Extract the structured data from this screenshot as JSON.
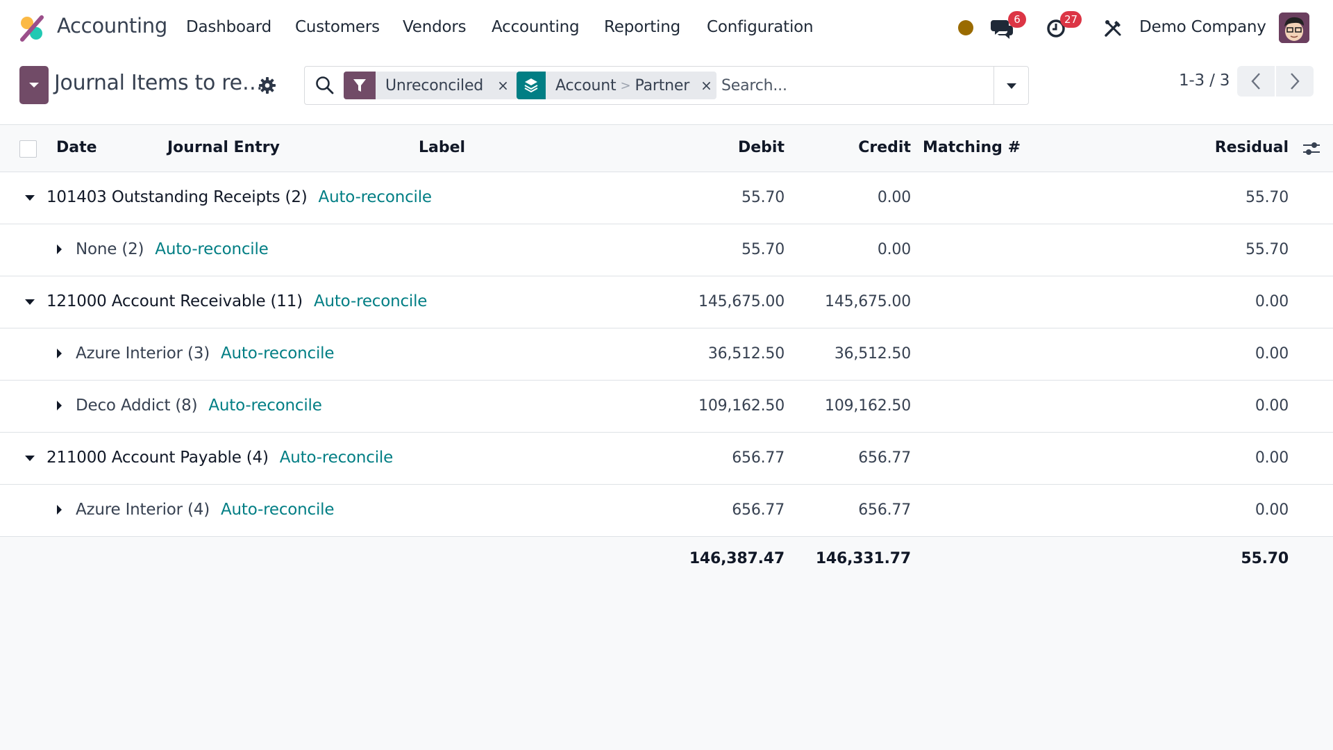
{
  "navbar": {
    "app_name": "Accounting",
    "menu": [
      "Dashboard",
      "Customers",
      "Vendors",
      "Accounting",
      "Reporting",
      "Configuration"
    ],
    "status_color": "#9a6b00",
    "messages_count": "6",
    "activities_count": "27",
    "company": "Demo Company"
  },
  "control_panel": {
    "title": "Journal Items to re…",
    "search": {
      "facets": [
        {
          "type": "filter",
          "icon": "filter-icon",
          "color": "#714b67",
          "values": [
            "Unreconciled"
          ]
        },
        {
          "type": "group_by",
          "icon": "layers-icon",
          "color": "#017e84",
          "values": [
            "Account",
            "Partner"
          ],
          "separator": ">"
        }
      ],
      "placeholder": "Search..."
    },
    "pager": "1-3 / 3"
  },
  "table": {
    "columns": [
      "Date",
      "Journal Entry",
      "Label",
      "Debit",
      "Credit",
      "Matching #",
      "Residual"
    ],
    "action_label": "Auto-reconcile",
    "rows": [
      {
        "level": 0,
        "expanded": true,
        "name": "101403 Outstanding Receipts (2)",
        "debit": "55.70",
        "credit": "0.00",
        "residual": "55.70"
      },
      {
        "level": 1,
        "expanded": false,
        "name": "None (2)",
        "debit": "55.70",
        "credit": "0.00",
        "residual": "55.70"
      },
      {
        "level": 0,
        "expanded": true,
        "name": "121000 Account Receivable (11)",
        "debit": "145,675.00",
        "credit": "145,675.00",
        "residual": "0.00"
      },
      {
        "level": 1,
        "expanded": false,
        "name": "Azure Interior (3)",
        "debit": "36,512.50",
        "credit": "36,512.50",
        "residual": "0.00"
      },
      {
        "level": 1,
        "expanded": false,
        "name": "Deco Addict (8)",
        "debit": "109,162.50",
        "credit": "109,162.50",
        "residual": "0.00"
      },
      {
        "level": 0,
        "expanded": true,
        "name": "211000 Account Payable (4)",
        "debit": "656.77",
        "credit": "656.77",
        "residual": "0.00"
      },
      {
        "level": 1,
        "expanded": false,
        "name": "Azure Interior (4)",
        "debit": "656.77",
        "credit": "656.77",
        "residual": "0.00"
      }
    ],
    "totals": {
      "debit": "146,387.47",
      "credit": "146,331.77",
      "residual": "55.70"
    }
  },
  "colors": {
    "brand": "#714b67",
    "link": "#017e84",
    "badge": "#dc3545"
  }
}
